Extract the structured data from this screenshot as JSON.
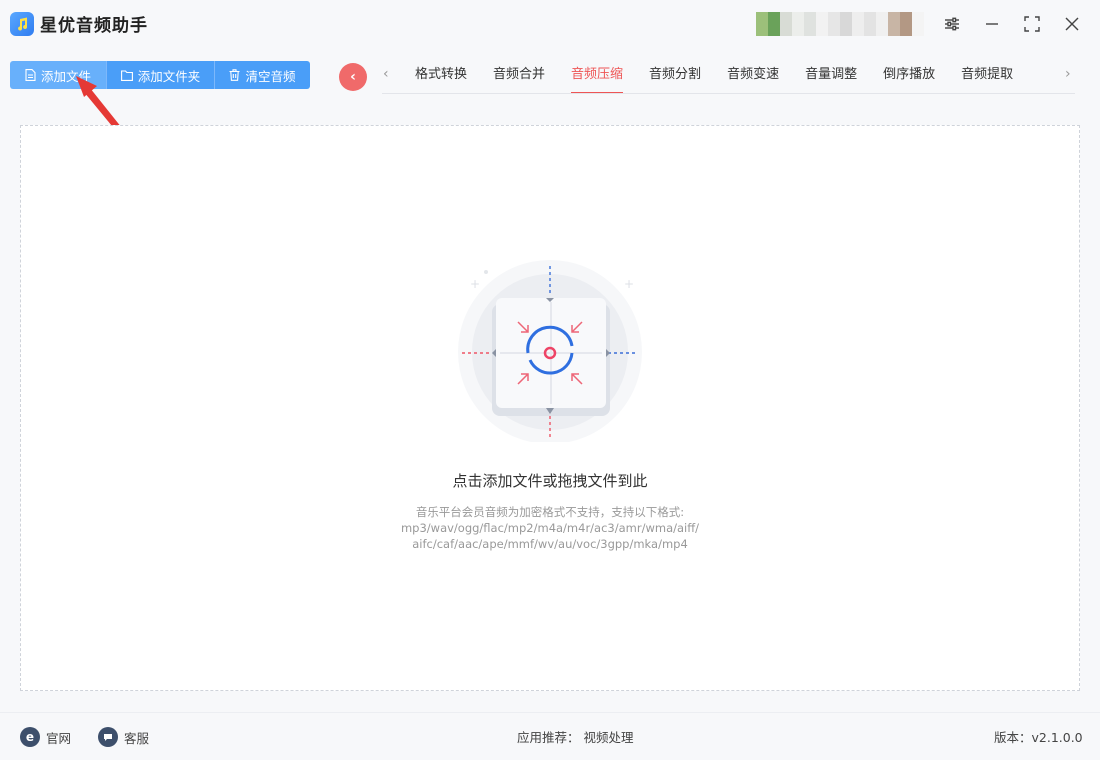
{
  "app": {
    "title": "星优音频助手"
  },
  "toolbar": {
    "add_file": "添加文件",
    "add_folder": "添加文件夹",
    "clear_audio": "清空音频"
  },
  "nav": {
    "back": "‹",
    "prev_arrow": "‹",
    "next_arrow": "›"
  },
  "tabs": [
    {
      "label": "格式转换",
      "active": false
    },
    {
      "label": "音频合并",
      "active": false
    },
    {
      "label": "音频压缩",
      "active": true
    },
    {
      "label": "音频分割",
      "active": false
    },
    {
      "label": "音频变速",
      "active": false
    },
    {
      "label": "音量调整",
      "active": false
    },
    {
      "label": "倒序播放",
      "active": false
    },
    {
      "label": "音频提取",
      "active": false
    }
  ],
  "dropzone": {
    "title": "点击添加文件或拖拽文件到此",
    "line1": "音乐平台会员音频为加密格式不支持，支持以下格式:",
    "line2": "mp3/wav/ogg/flac/mp2/m4a/m4r/ac3/amr/wma/aiff/",
    "line3": "aifc/caf/aac/ape/mmf/wv/au/voc/3gpp/mka/mp4"
  },
  "footer": {
    "website": "官网",
    "support": "客服",
    "recommend_label": "应用推荐：",
    "recommend_link": "视频处理",
    "version": "版本：v2.1.0.0"
  },
  "colors": {
    "accent_blue": "#4a9ef8",
    "active_tab": "#ee5555",
    "arrow_red": "#e53935"
  }
}
